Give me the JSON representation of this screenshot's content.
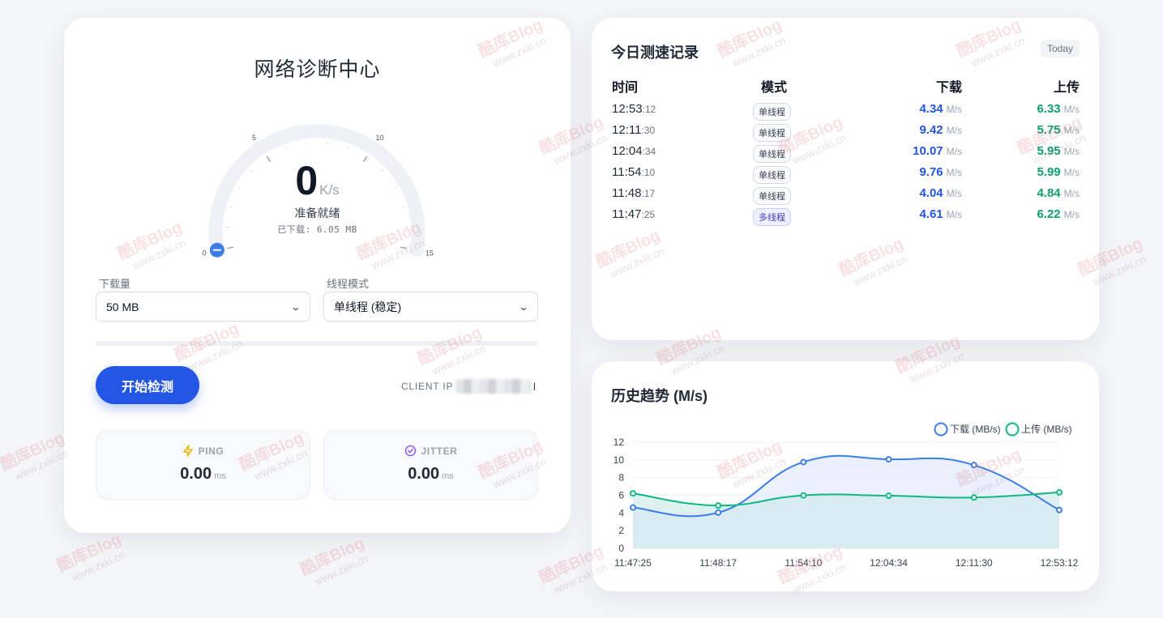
{
  "diagnosis": {
    "title": "网络诊断中心",
    "gauge": {
      "speed": "0",
      "unit": "K/s",
      "status": "准备就绪",
      "downloaded": "已下载: 6.05 MB",
      "ticks": [
        "0",
        "5",
        "10",
        "15"
      ],
      "max": 15,
      "value": 0,
      "track_color": "#eef1f6",
      "needle_color": "#3b7de9"
    },
    "download_amount": {
      "label": "下载量",
      "value": "50 MB"
    },
    "thread_mode": {
      "label": "线程模式",
      "value": "单线程 (稳定)"
    },
    "progress_fraction": 0,
    "start_button": "开始检测",
    "client_ip_label": "CLIENT IP",
    "client_ip_tail": "l",
    "ping": {
      "label": "PING",
      "value": "0.00",
      "unit": "ms",
      "icon": "lightning-icon",
      "icon_color": "#eab308"
    },
    "jitter": {
      "label": "JITTER",
      "value": "0.00",
      "unit": "ms",
      "icon": "check-circle-icon",
      "icon_color": "#8b5cf6"
    }
  },
  "records": {
    "title": "今日测速记录",
    "badge": "Today",
    "headers": {
      "time": "时间",
      "mode": "模式",
      "download": "下载",
      "upload": "上传"
    },
    "unit": "M/s",
    "rows": [
      {
        "hm": "12:53",
        "sec": ":12",
        "mode": "单线程",
        "multi": false,
        "down": "4.34",
        "up": "6.33"
      },
      {
        "hm": "12:11",
        "sec": ":30",
        "mode": "单线程",
        "multi": false,
        "down": "9.42",
        "up": "5.75"
      },
      {
        "hm": "12:04",
        "sec": ":34",
        "mode": "单线程",
        "multi": false,
        "down": "10.07",
        "up": "5.95"
      },
      {
        "hm": "11:54",
        "sec": ":10",
        "mode": "单线程",
        "multi": false,
        "down": "9.76",
        "up": "5.99"
      },
      {
        "hm": "11:48",
        "sec": ":17",
        "mode": "单线程",
        "multi": false,
        "down": "4.04",
        "up": "4.84"
      },
      {
        "hm": "11:47",
        "sec": ":25",
        "mode": "多线程",
        "multi": true,
        "down": "4.61",
        "up": "6.22"
      }
    ]
  },
  "trend": {
    "title": "历史趋势 (M/s)"
  },
  "chart_data": {
    "type": "line",
    "categories": [
      "11:47:25",
      "11:48:17",
      "11:54:10",
      "12:04:34",
      "12:11:30",
      "12:53:12"
    ],
    "series": [
      {
        "name": "下载 (MB/s)",
        "values": [
          4.61,
          4.04,
          9.76,
          10.07,
          9.42,
          4.34
        ],
        "color": "#3b7de9",
        "fill": "#e3ebfb"
      },
      {
        "name": "上传 (MB/s)",
        "values": [
          6.22,
          4.84,
          5.99,
          5.95,
          5.75,
          6.33
        ],
        "color": "#10b981",
        "fill": "#d3e9ee"
      }
    ],
    "yticks": [
      "0",
      "2",
      "4",
      "6",
      "8",
      "10",
      "12"
    ],
    "ylim": [
      0,
      12
    ],
    "legend": "top-right",
    "grid": true,
    "area": true
  },
  "watermark": {
    "brand": "酷库Blog",
    "url": "www.zxki.cn"
  }
}
